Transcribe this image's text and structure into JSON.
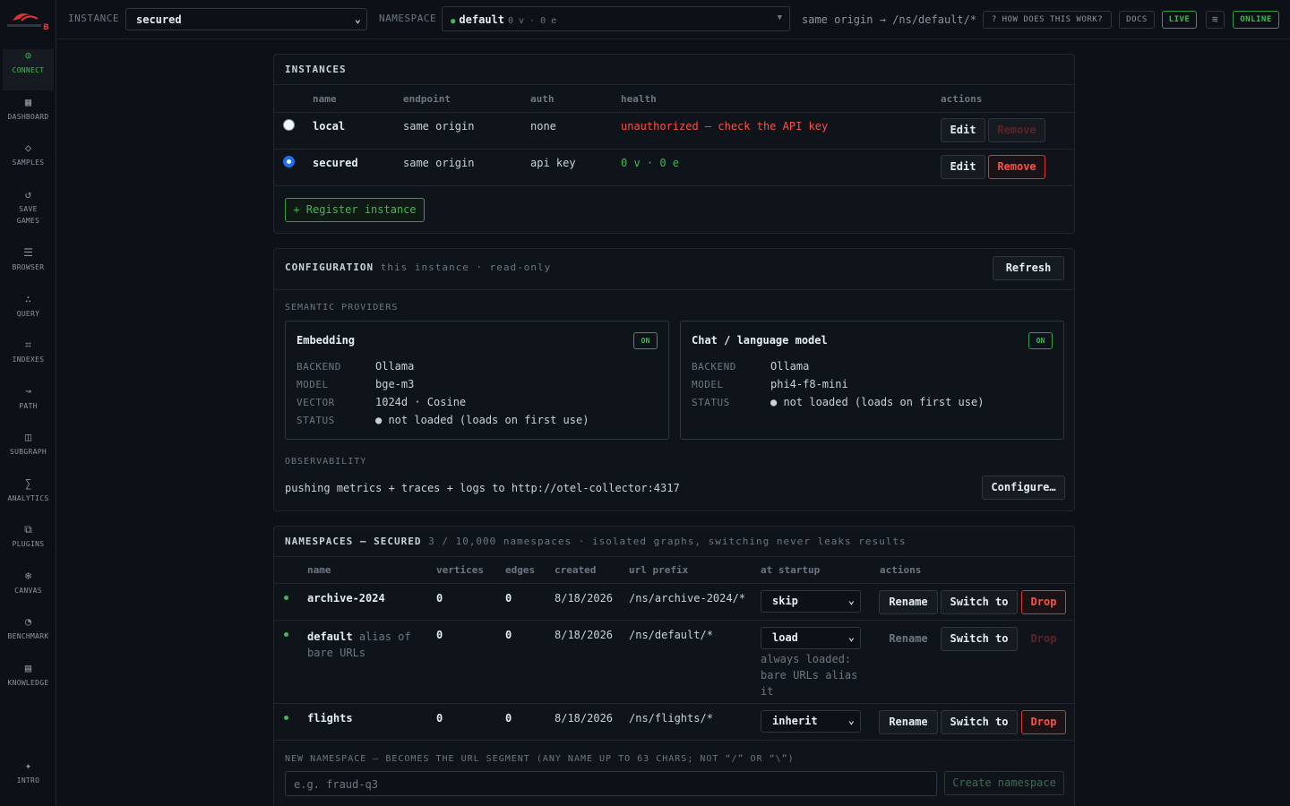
{
  "brand": {
    "logo_text": "B"
  },
  "sidebar": {
    "items": [
      {
        "label": "CONNECT",
        "icon": "⊙"
      },
      {
        "label": "DASHBOARD",
        "icon": "▦"
      },
      {
        "label": "SAMPLES",
        "icon": "◇"
      },
      {
        "label": "SAVE",
        "label2": "GAMES",
        "icon": "↺"
      },
      {
        "label": "BROWSER",
        "icon": "☰"
      },
      {
        "label": "QUERY",
        "icon": "∴"
      },
      {
        "label": "INDEXES",
        "icon": "⌗"
      },
      {
        "label": "PATH",
        "icon": "↝"
      },
      {
        "label": "SUBGRAPH",
        "icon": "◫"
      },
      {
        "label": "ANALYTICS",
        "icon": "∑"
      },
      {
        "label": "PLUGINS",
        "icon": "⧉"
      },
      {
        "label": "CANVAS",
        "icon": "❄"
      },
      {
        "label": "BENCHMARK",
        "icon": "◔"
      },
      {
        "label": "KNOWLEDGE",
        "icon": "▤"
      }
    ],
    "intro": {
      "label": "INTRO",
      "icon": "✦"
    }
  },
  "topbar": {
    "instance_label": "INSTANCE",
    "instance_value": "secured",
    "namespace_label": "NAMESPACE",
    "namespace_value": "default",
    "namespace_counts": "0 v · 0 e",
    "route": "same origin → /ns/default/*",
    "how_label": "? HOW DOES THIS WORK?",
    "docs_label": "DOCS",
    "live_label": "LIVE",
    "online_label": "ONLINE"
  },
  "instances": {
    "title": "INSTANCES",
    "headers": {
      "name": "name",
      "endpoint": "endpoint",
      "auth": "auth",
      "health": "health",
      "actions": "actions"
    },
    "rows": [
      {
        "name": "local",
        "endpoint": "same origin",
        "auth": "none",
        "health": "unauthorized — check the API key",
        "edit": "Edit",
        "remove": "Remove"
      },
      {
        "name": "secured",
        "endpoint": "same origin",
        "auth": "api key",
        "health": "0 v · 0 e",
        "edit": "Edit",
        "remove": "Remove"
      }
    ],
    "register_label": "+ Register instance"
  },
  "configuration": {
    "title": "CONFIGURATION",
    "subtitle": "this instance · read-only",
    "refresh_label": "Refresh",
    "semantic_label": "SEMANTIC PROVIDERS",
    "embedding": {
      "title": "Embedding",
      "badge": "ON",
      "k_backend": "BACKEND",
      "backend": "Ollama",
      "k_model": "MODEL",
      "model": "bge-m3",
      "k_vector": "VECTOR",
      "vector": "1024d · Cosine",
      "k_status": "STATUS",
      "status": "● not loaded (loads on first use)"
    },
    "chat": {
      "title": "Chat / language model",
      "badge": "ON",
      "k_backend": "BACKEND",
      "backend": "Ollama",
      "k_model": "MODEL",
      "model": "phi4-f8-mini",
      "k_status": "STATUS",
      "status": "● not loaded (loads on first use)"
    },
    "observability_label": "OBSERVABILITY",
    "observability_text": "pushing metrics + traces + logs to http://otel-collector:4317",
    "configure_label": "Configure…"
  },
  "namespaces": {
    "title": "NAMESPACES — SECURED",
    "subtitle": "3 / 10,000 namespaces · isolated graphs, switching never leaks results",
    "headers": {
      "name": "name",
      "vertices": "vertices",
      "edges": "edges",
      "created": "created",
      "url_prefix": "url prefix",
      "startup": "at startup",
      "actions": "actions"
    },
    "rows": [
      {
        "name": "archive-2024",
        "alias": "",
        "vertices": "0",
        "edges": "0",
        "created": "8/18/2026",
        "url": "/ns/archive-2024/*",
        "startup": "skip",
        "note": "",
        "rename": "Rename",
        "switch": "Switch to",
        "drop": "Drop"
      },
      {
        "name": "default",
        "alias": "alias of bare URLs",
        "vertices": "0",
        "edges": "0",
        "created": "8/18/2026",
        "url": "/ns/default/*",
        "startup": "load",
        "note": "always loaded: bare URLs alias it",
        "rename": "Rename",
        "switch": "Switch to",
        "drop": "Drop"
      },
      {
        "name": "flights",
        "alias": "",
        "vertices": "0",
        "edges": "0",
        "created": "8/18/2026",
        "url": "/ns/flights/*",
        "startup": "inherit",
        "note": "",
        "rename": "Rename",
        "switch": "Switch to",
        "drop": "Drop"
      }
    ],
    "new_label": "NEW NAMESPACE — BECOMES THE URL SEGMENT (ANY NAME UP TO 63 CHARS; NOT “/” OR “\\”)",
    "new_placeholder": "e.g. fraud-q3",
    "create_label": "Create namespace"
  }
}
